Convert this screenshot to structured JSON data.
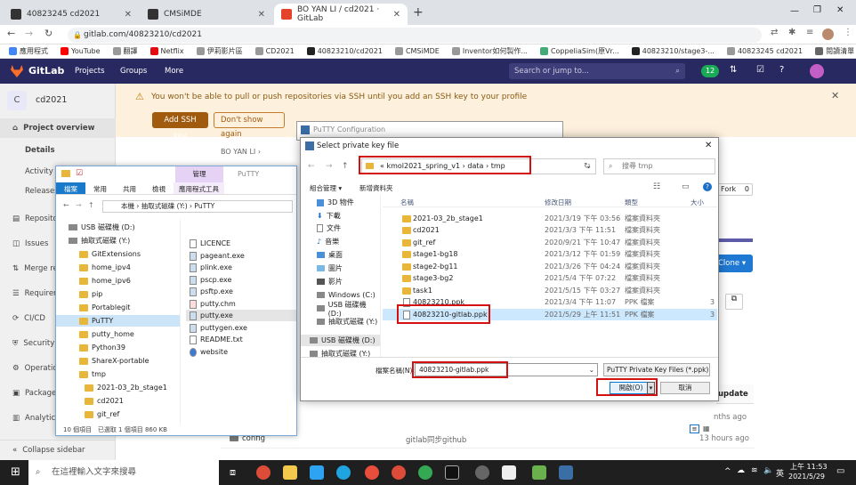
{
  "browser": {
    "tabs": [
      {
        "label": "40823245 cd2021",
        "color": "#333"
      },
      {
        "label": "CMSiMDE",
        "color": "#333"
      },
      {
        "label": "BO YAN LI / cd2021 · GitLab",
        "color": "#e2432a"
      }
    ],
    "url": "gitlab.com/40823210/cd2021",
    "bookmarks": [
      "應用程式",
      "YouTube",
      "翻譯",
      "Netflix",
      "伊莉影片區",
      "CD2021",
      "40823210/cd2021",
      "CMSiMDE",
      "Inventor如何製作...",
      "CoppeliaSim(原Vr...",
      "40823210/stage3-...",
      "40823245 cd2021"
    ],
    "reading_list": "閱讀清單"
  },
  "gitlab": {
    "brand": "GitLab",
    "nav": [
      "Projects",
      "Groups",
      "More"
    ],
    "search_placeholder": "Search or jump to...",
    "badge_count": "12",
    "project_initial": "C",
    "project_name": "cd2021",
    "sidebar": [
      {
        "label": "Project overview",
        "icon": "home-icon"
      },
      {
        "label": "Details",
        "icon": ""
      },
      {
        "label": "Activity",
        "icon": ""
      },
      {
        "label": "Releases",
        "icon": ""
      },
      {
        "label": "Repository",
        "icon": "doc-icon"
      },
      {
        "label": "Issues",
        "icon": "issues-icon"
      },
      {
        "label": "Merge requests",
        "icon": "merge-icon"
      },
      {
        "label": "Requirements",
        "icon": "req-icon"
      },
      {
        "label": "CI/CD",
        "icon": "cicd-icon"
      },
      {
        "label": "Security & Compliance",
        "icon": "shield-icon"
      },
      {
        "label": "Operations",
        "icon": "ops-icon"
      },
      {
        "label": "Packages & Registries",
        "icon": "package-icon"
      },
      {
        "label": "Analytics",
        "icon": "analytics-icon"
      }
    ],
    "collapse": "Collapse sidebar",
    "banner_text": "You won't be able to pull or push repositories via SSH until you add an SSH key to your profile",
    "add_ssh": "Add SSH key",
    "dont_show": "Don't show again",
    "breadcrumb_user": "BO YAN LI",
    "fork": "Fork",
    "fork_count": "0",
    "clone": "Clone",
    "update_header": "update",
    "rows": [
      {
        "name": "config",
        "msg": "gitlab同步github",
        "time": "13 hours ago"
      }
    ],
    "row_time_partial": "nths ago"
  },
  "explorer": {
    "ribbon_tabs": [
      "檔案",
      "常用",
      "共用",
      "檢視",
      "應用程式工具"
    ],
    "manage_tab": "管理",
    "putty_title": "PuTTY",
    "path": [
      "本機",
      "抽取式磁碟 (Y:)",
      "PuTTY"
    ],
    "tree": [
      "USB 磁碟機 (D:)",
      "抽取式磁碟 (Y:)",
      "GitExtensions",
      "home_ipv4",
      "home_ipv6",
      "pip",
      "Portablegit",
      "PuTTY",
      "putty_home",
      "Python39",
      "ShareX-portable",
      "tmp",
      "2021-03_2b_stage1",
      "cd2021",
      "git_ref"
    ],
    "files": [
      "LICENCE",
      "pageant.exe",
      "plink.exe",
      "pscp.exe",
      "psftp.exe",
      "putty.chm",
      "putty.exe",
      "puttygen.exe",
      "README.txt",
      "website"
    ],
    "status_items": "10 個項目",
    "status_selected": "已選取 1 個項目 860 KB"
  },
  "putty_config_title": "PuTTY Configuration",
  "dialog": {
    "title": "Select private key file",
    "breadcrumb": [
      "«",
      "kmol2021_spring_v1",
      "data",
      "tmp"
    ],
    "search_placeholder": "搜尋 tmp",
    "organize": "組合管理",
    "new_folder": "新增資料夾",
    "nav_items": [
      "3D 物件",
      "下載",
      "文件",
      "音樂",
      "桌面",
      "圖片",
      "影片",
      "Windows (C:)",
      "USB 磁碟機 (D:)",
      "抽取式磁碟 (Y:)",
      "USB 磁碟機 (D:)",
      "抽取式磁碟 (Y:)"
    ],
    "columns": [
      "名稱",
      "修改日期",
      "類型",
      "大小"
    ],
    "files": [
      {
        "name": "2021-03_2b_stage1",
        "date": "2021/3/19 下午 03:56",
        "type": "檔案資料夾",
        "size": "",
        "kind": "folder"
      },
      {
        "name": "cd2021",
        "date": "2021/3/3 下午 11:51",
        "type": "檔案資料夾",
        "size": "",
        "kind": "folder"
      },
      {
        "name": "git_ref",
        "date": "2020/9/21 下午 10:47",
        "type": "檔案資料夾",
        "size": "",
        "kind": "folder"
      },
      {
        "name": "stage1-bg18",
        "date": "2021/3/12 下午 01:59",
        "type": "檔案資料夾",
        "size": "",
        "kind": "folder"
      },
      {
        "name": "stage2-bg11",
        "date": "2021/3/26 下午 04:24",
        "type": "檔案資料夾",
        "size": "",
        "kind": "folder"
      },
      {
        "name": "stage3-bg2",
        "date": "2021/5/4 下午 07:22",
        "type": "檔案資料夾",
        "size": "",
        "kind": "folder"
      },
      {
        "name": "task1",
        "date": "2021/5/15 下午 03:27",
        "type": "檔案資料夾",
        "size": "",
        "kind": "folder"
      },
      {
        "name": "40823210.ppk",
        "date": "2021/3/4 下午 11:07",
        "type": "PPK 檔案",
        "size": "3",
        "kind": "file"
      },
      {
        "name": "40823210-gitlab.ppk",
        "date": "2021/5/29 上午 11:51",
        "type": "PPK 檔案",
        "size": "3",
        "kind": "file"
      }
    ],
    "filename_label": "檔案名稱(N):",
    "filename_value": "40823210-gitlab.ppk",
    "filetype": "PuTTY Private Key Files (*.ppk)",
    "open": "開啟(O)",
    "cancel": "取消"
  },
  "taskbar": {
    "search_placeholder": "在這裡輸入文字來搜尋",
    "time": "上午 11:53",
    "date": "2021/5/29",
    "ime": "英"
  }
}
